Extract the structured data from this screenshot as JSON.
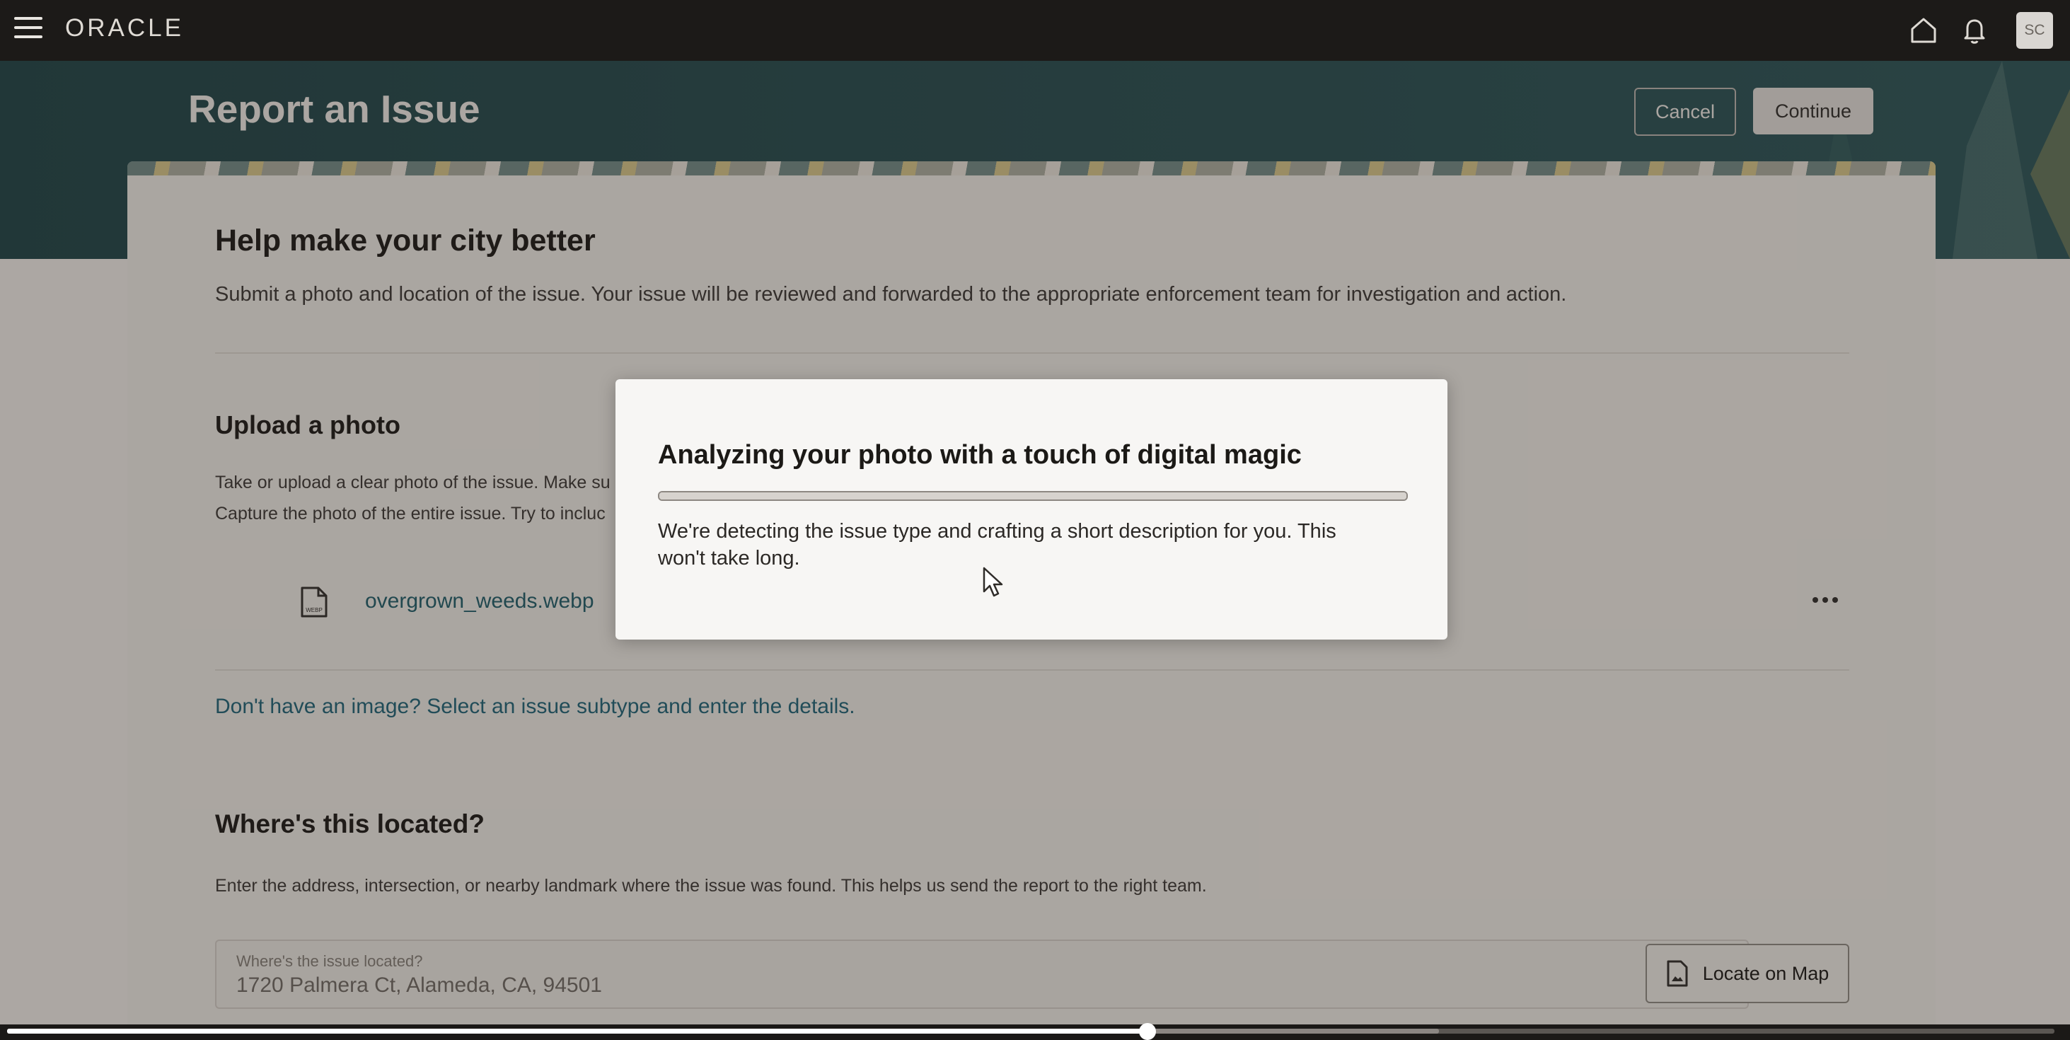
{
  "topbar": {
    "logo": "ORACLE",
    "avatar_initials": "SC",
    "icons": [
      "menu-icon",
      "home-icon",
      "bell-icon"
    ]
  },
  "header": {
    "title": "Report an Issue",
    "cancel_label": "Cancel",
    "continue_label": "Continue"
  },
  "intro": {
    "heading": "Help make your city better",
    "text": "Submit a photo and location of the issue. Your issue will be reviewed and forwarded to the appropriate enforcement team for investigation and action."
  },
  "upload": {
    "heading": "Upload a photo",
    "line1": "Take or upload a clear photo of the issue. Make su",
    "line2": "Capture the photo of the entire issue. Try to incluc",
    "file_name": "overgrown_weeds.webp",
    "file_icon_label": "WEBP",
    "no_image_link": "Don't have an image? Select an issue subtype and enter the details."
  },
  "location": {
    "heading": "Where's this located?",
    "text": "Enter the address, intersection, or nearby landmark where the issue was found. This helps us send the report to the right team.",
    "field_label": "Where's the issue located?",
    "field_value": "1720 Palmera Ct, Alameda, CA, 94501",
    "locate_button": "Locate on Map"
  },
  "dialog": {
    "title": "Analyzing your photo with a touch of digital magic",
    "body": "We're detecting the issue type and crafting a short description for you. This won't take long.",
    "progress": 1.0
  },
  "video": {
    "played_fraction": 0.557
  },
  "colors": {
    "topbar": "#1c1a18",
    "banner": "#25494c",
    "link": "#1f6275",
    "dialog_bg": "#f7f6f4"
  }
}
